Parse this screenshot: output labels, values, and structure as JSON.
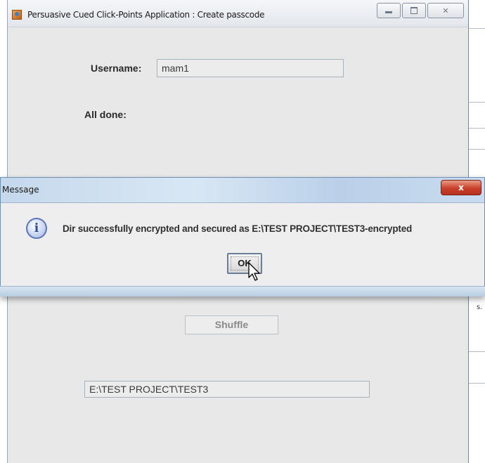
{
  "main_window": {
    "title": "Persuasive Cued Click-Points Application : Create passcode",
    "controls": {
      "minimize_icon": "minimize-icon",
      "maximize_icon": "maximize-icon",
      "close_glyph": "✕"
    }
  },
  "form": {
    "username_label": "Username:",
    "username_value": "mam1",
    "status_label": "All done:",
    "shuffle_label": "Shuffle",
    "path_value": "E:\\TEST PROJECT\\TEST3"
  },
  "dialog": {
    "title": "Message",
    "close_glyph": "x",
    "icon": "info-icon",
    "icon_glyph": "i",
    "message": "Dir successfully encrypted and secured as E:\\TEST PROJECT\\TEST3-encrypted",
    "ok_label": "OK"
  },
  "right_edge": {
    "text": "s."
  },
  "colors": {
    "window_bg": "#e8e8e8",
    "dialog_title_accent": "#c5d8ec",
    "close_red": "#c8402a",
    "info_blue": "#5a76b8"
  }
}
